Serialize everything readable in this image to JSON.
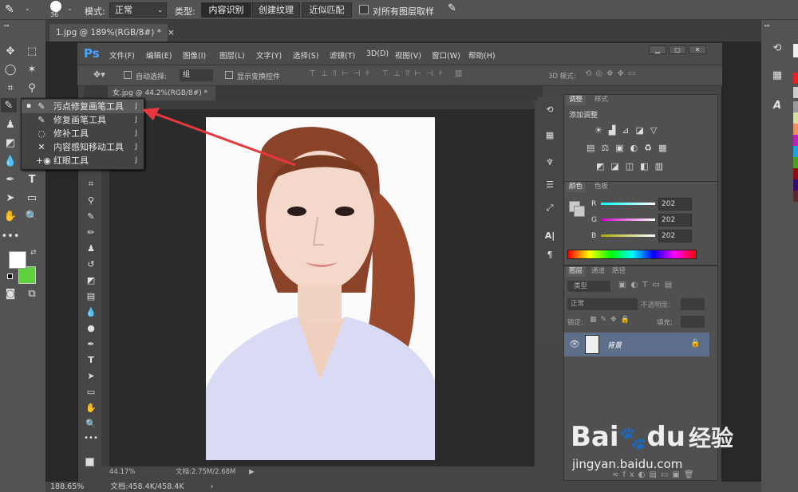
{
  "options_bar": {
    "brush_size": "36",
    "mode_label": "模式:",
    "mode_value": "正常",
    "type_label": "类型:",
    "type_buttons": [
      "内容识别",
      "创建纹理",
      "近似匹配"
    ],
    "sample_all_layers": "对所有图层取样"
  },
  "document_tab": {
    "title": "1.jpg @ 189%(RGB/8#) *",
    "close": "×"
  },
  "status_bar": {
    "zoom": "188.65%",
    "doc": "文档:458.4K/458.4K"
  },
  "flyout": {
    "items": [
      {
        "label": "污点修复画笔工具",
        "key": "J",
        "icon": "spot-healing-brush-icon",
        "glyph": "✎"
      },
      {
        "label": "修复画笔工具",
        "key": "J",
        "icon": "healing-brush-icon",
        "glyph": "✎"
      },
      {
        "label": "修补工具",
        "key": "J",
        "icon": "patch-tool-icon",
        "glyph": "◌"
      },
      {
        "label": "内容感知移动工具",
        "key": "J",
        "icon": "content-aware-move-icon",
        "glyph": "✕"
      },
      {
        "label": "红眼工具",
        "key": "J",
        "icon": "red-eye-icon",
        "glyph": "+◉"
      }
    ]
  },
  "inner_window": {
    "logo": "Ps",
    "menus": [
      "文件(F)",
      "编辑(E)",
      "图像(I)",
      "图层(L)",
      "文字(Y)",
      "选择(S)",
      "滤镜(T)",
      "3D(D)",
      "视图(V)",
      "窗口(W)",
      "帮助(H)"
    ],
    "auto_select": "自动选择:",
    "auto_select_value": "组",
    "show_transform": "显示变换控件",
    "mode_3d": "3D 模式:",
    "doc_tab": "女.jpg @ 44.2%(RGB/8#) *",
    "zoom": "44.17%",
    "doc_size": "文档:2.75M/2.68M",
    "adjust_tabs": [
      "调整",
      "样式"
    ],
    "adjust_heading": "添加调整",
    "color_tabs": [
      "颜色",
      "色板"
    ],
    "color_values": {
      "r_label": "R",
      "r": "202",
      "g_label": "G",
      "g": "202",
      "b_label": "B",
      "b": "202"
    },
    "layers_tabs": [
      "图层",
      "通道",
      "路径"
    ],
    "layer_kind": "类型",
    "blend_mode": "正常",
    "opacity_label": "不透明度:",
    "lock_label": "锁定:",
    "fill_label": "填充:",
    "layer_name": "背景"
  },
  "watermark": {
    "brand": "Bai",
    "brand2": "du",
    "tail": "经验",
    "url": "jingyan.baidu.com"
  },
  "colors": {
    "accent_arrow": "#e8383d",
    "background_swatch": "#5ed03b",
    "foreground_swatch": "#ffffff"
  }
}
